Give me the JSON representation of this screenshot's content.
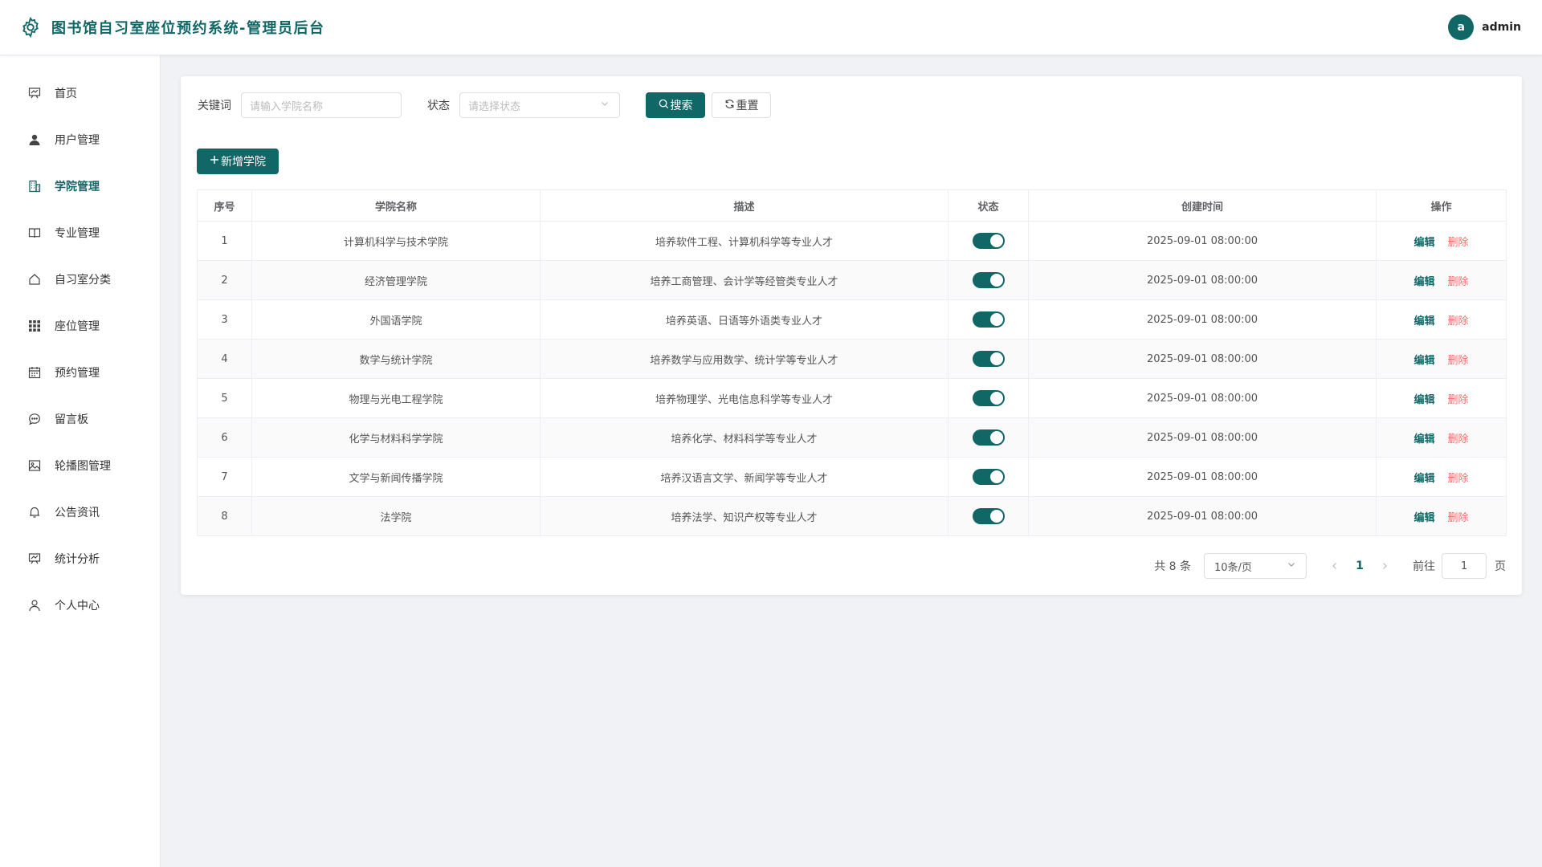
{
  "header": {
    "title": "图书馆自习室座位预约系统-管理员后台",
    "avatar_letter": "a",
    "username": "admin"
  },
  "sidebar": {
    "items": [
      {
        "label": "首页",
        "icon": "dashboard-icon",
        "active": false
      },
      {
        "label": "用户管理",
        "icon": "user-icon",
        "active": false
      },
      {
        "label": "学院管理",
        "icon": "building-icon",
        "active": true
      },
      {
        "label": "专业管理",
        "icon": "book-icon",
        "active": false
      },
      {
        "label": "自习室分类",
        "icon": "house-icon",
        "active": false
      },
      {
        "label": "座位管理",
        "icon": "grid-icon",
        "active": false
      },
      {
        "label": "预约管理",
        "icon": "calendar-icon",
        "active": false
      },
      {
        "label": "留言板",
        "icon": "chat-icon",
        "active": false
      },
      {
        "label": "轮播图管理",
        "icon": "picture-icon",
        "active": false
      },
      {
        "label": "公告资讯",
        "icon": "bell-icon",
        "active": false
      },
      {
        "label": "统计分析",
        "icon": "chart-icon",
        "active": false
      },
      {
        "label": "个人中心",
        "icon": "person-icon",
        "active": false
      }
    ]
  },
  "filters": {
    "keyword_label": "关键词",
    "keyword_placeholder": "请输入学院名称",
    "status_label": "状态",
    "status_placeholder": "请选择状态",
    "search_label": "搜索",
    "reset_label": "重置"
  },
  "add_button_label": "新增学院",
  "table": {
    "columns": [
      "序号",
      "学院名称",
      "描述",
      "状态",
      "创建时间",
      "操作"
    ],
    "edit_label": "编辑",
    "delete_label": "删除",
    "rows": [
      {
        "index": "1",
        "name": "计算机科学与技术学院",
        "desc": "培养软件工程、计算机科学等专业人才",
        "enabled": true,
        "created": "2025-09-01 08:00:00"
      },
      {
        "index": "2",
        "name": "经济管理学院",
        "desc": "培养工商管理、会计学等经管类专业人才",
        "enabled": true,
        "created": "2025-09-01 08:00:00"
      },
      {
        "index": "3",
        "name": "外国语学院",
        "desc": "培养英语、日语等外语类专业人才",
        "enabled": true,
        "created": "2025-09-01 08:00:00"
      },
      {
        "index": "4",
        "name": "数学与统计学院",
        "desc": "培养数学与应用数学、统计学等专业人才",
        "enabled": true,
        "created": "2025-09-01 08:00:00"
      },
      {
        "index": "5",
        "name": "物理与光电工程学院",
        "desc": "培养物理学、光电信息科学等专业人才",
        "enabled": true,
        "created": "2025-09-01 08:00:00"
      },
      {
        "index": "6",
        "name": "化学与材料科学学院",
        "desc": "培养化学、材料科学等专业人才",
        "enabled": true,
        "created": "2025-09-01 08:00:00"
      },
      {
        "index": "7",
        "name": "文学与新闻传播学院",
        "desc": "培养汉语言文学、新闻学等专业人才",
        "enabled": true,
        "created": "2025-09-01 08:00:00"
      },
      {
        "index": "8",
        "name": "法学院",
        "desc": "培养法学、知识产权等专业人才",
        "enabled": true,
        "created": "2025-09-01 08:00:00"
      }
    ]
  },
  "pagination": {
    "total_text": "共 8 条",
    "page_size": "10条/页",
    "current_page": "1",
    "goto_label": "前往",
    "goto_value": "1",
    "page_suffix": "页"
  },
  "colors": {
    "primary": "#116666",
    "danger": "#f56c6c"
  }
}
